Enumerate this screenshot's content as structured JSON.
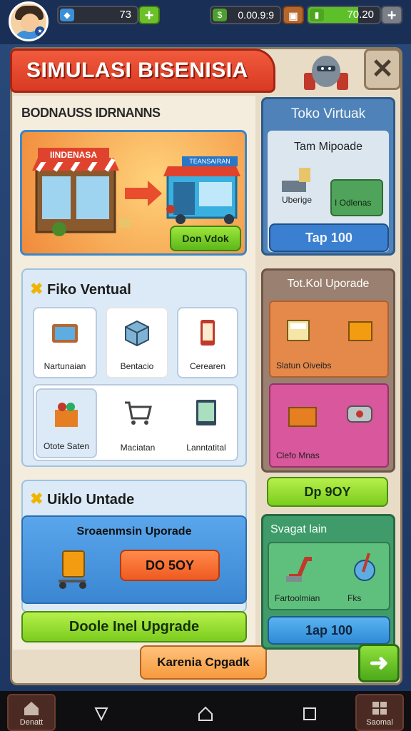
{
  "topbar": {
    "currency1": "73",
    "currency2": "0.00.9:9",
    "energy": "70.20",
    "plus": "+"
  },
  "header": {
    "title": "SIMULASI BISENISIA",
    "close": "✕"
  },
  "left": {
    "subheading": "BODNAUSS IDRNANNS",
    "hero": {
      "shop_label": "IINDENASA",
      "shop2_label": "TEANSAIRAN",
      "button": "Don Vdok"
    },
    "virtual_section": {
      "title": "Fiko Ventual",
      "items": [
        {
          "label": "Nartunaian"
        },
        {
          "label": "Bentacio"
        },
        {
          "label": "Cerearen"
        },
        {
          "label": "Otote Saten"
        },
        {
          "label": "Maciatan"
        },
        {
          "label": "Lanntatital"
        }
      ]
    },
    "upgrade_section": {
      "title": "Uiklo Untade",
      "box_title": "Sroaenmsin Uporade",
      "price_button": "DO 5OY",
      "wide_button": "Doole Inel Upgrade"
    },
    "bottom_button": "Karenia Cpgadk"
  },
  "right": {
    "card1": {
      "title": "Toko Virtuak",
      "subtitle": "Tam Mipoade",
      "item1": "Uberige",
      "item2": "I Odlenas",
      "button": "Tap 100"
    },
    "card2": {
      "title": "Tot.Kol Uporade",
      "item1": "Slatun Oiveibs",
      "item2": "Clefo Mnas"
    },
    "green_pill": "Dp 9OY",
    "card3": {
      "title": "Svagat lain",
      "item1": "Fartoolmian",
      "item2": "Fks",
      "button": "1ap 100"
    },
    "arrow": "➜"
  },
  "nav": {
    "left_label": "Denatt",
    "right_label": "Saomal"
  },
  "colors": {
    "accent_red": "#e0432d",
    "accent_green": "#7bcc1e",
    "accent_blue": "#3b86d2",
    "panel_bg": "#e9dcc7"
  }
}
